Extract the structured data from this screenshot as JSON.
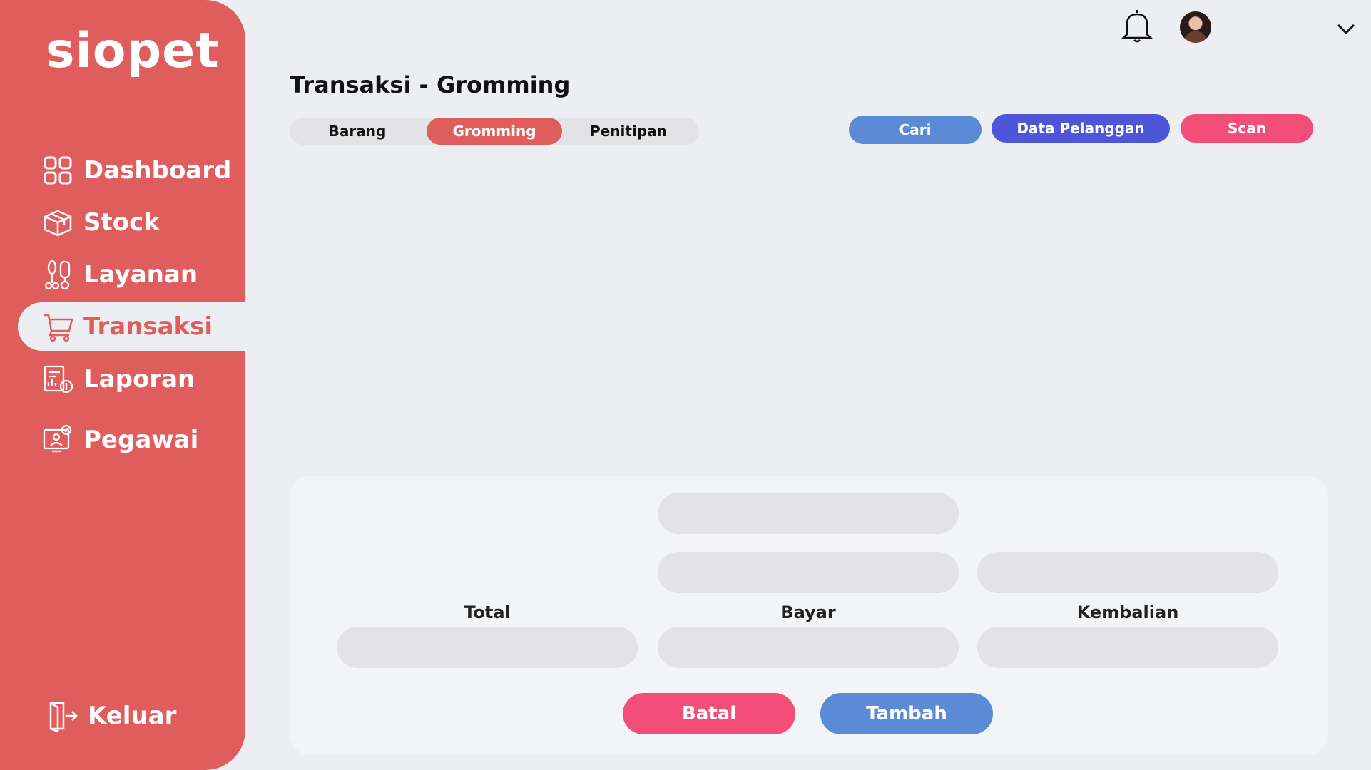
{
  "app": {
    "logo": "siopet"
  },
  "sidebar": {
    "items": [
      {
        "label": "Dashboard",
        "icon": "grid-icon"
      },
      {
        "label": "Stock",
        "icon": "box-icon"
      },
      {
        "label": "Layanan",
        "icon": "grooming-tools-icon"
      },
      {
        "label": "Transaksi",
        "icon": "cart-icon",
        "active": true
      },
      {
        "label": "Laporan",
        "icon": "report-icon"
      },
      {
        "label": "Pegawai",
        "icon": "employee-icon"
      }
    ],
    "logout": {
      "label": "Keluar",
      "icon": "logout-icon"
    }
  },
  "header": {
    "title": "Transaksi - Gromming"
  },
  "tabs": [
    {
      "label": "Barang"
    },
    {
      "label": "Gromming",
      "active": true
    },
    {
      "label": "Penitipan"
    }
  ],
  "toolbar": {
    "search_label": "Cari",
    "customers_label": "Data Pelanggan",
    "scan_label": "Scan"
  },
  "summary": {
    "total_label": "Total",
    "bayar_label": "Bayar",
    "kembalian_label": "Kembalian"
  },
  "actions": {
    "cancel_label": "Batal",
    "add_label": "Tambah"
  },
  "colors": {
    "brand": "#e05d5e",
    "search": "#5b8bd6",
    "customers": "#4f55d8",
    "scan": "#f24e78",
    "cancel": "#f24e78",
    "add": "#5b8bd6"
  }
}
